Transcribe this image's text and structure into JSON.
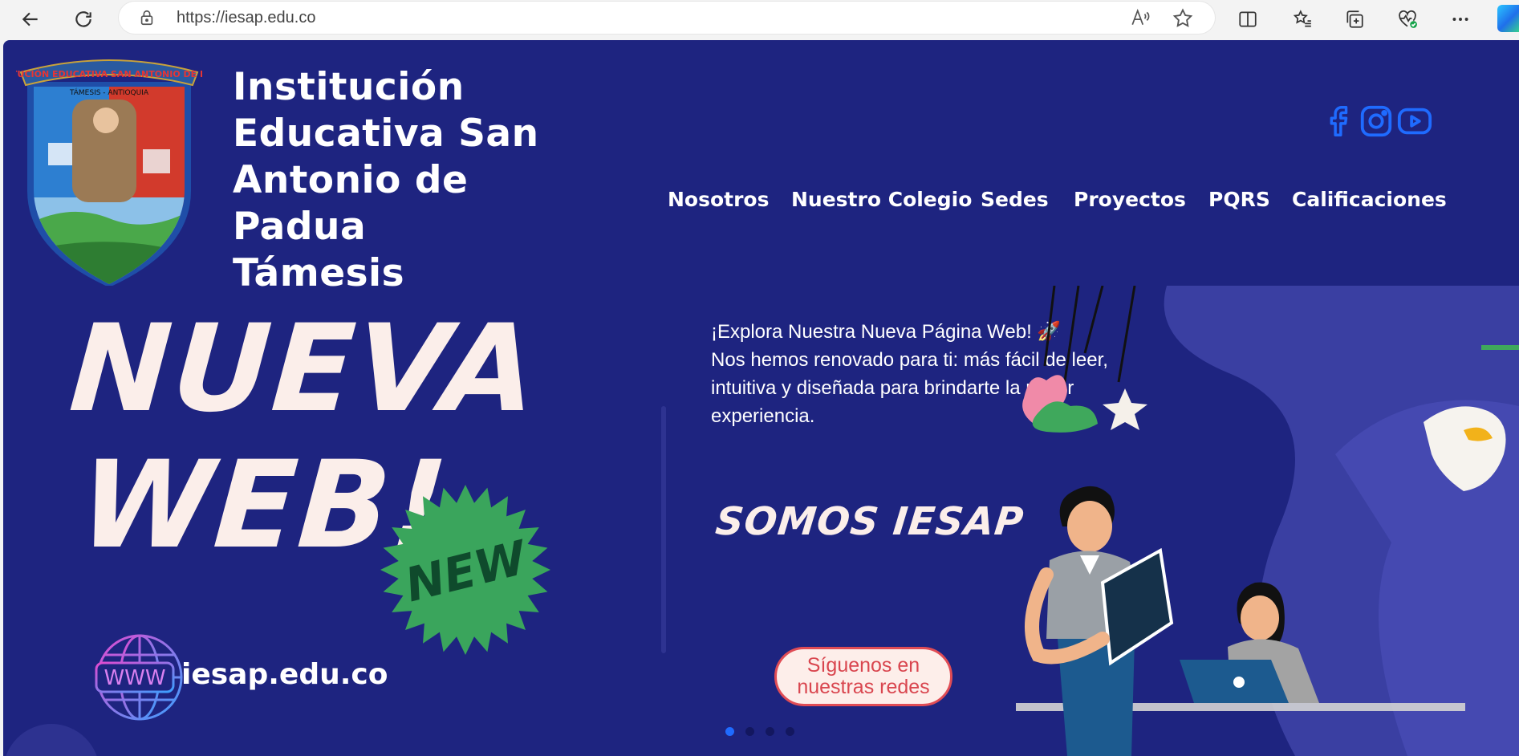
{
  "browser": {
    "url": "https://iesap.edu.co",
    "icons": [
      "back-icon",
      "refresh-icon",
      "lock-icon",
      "read-aloud-icon",
      "favorite-star-icon",
      "split-screen-icon",
      "favorites-icon",
      "collections-icon",
      "browser-essentials-icon",
      "more-icon",
      "copilot-icon"
    ]
  },
  "header": {
    "school_name_lines": [
      "Institución",
      "Educativa San",
      "Antonio de Padua",
      "Támesis"
    ],
    "crest_text": {
      "top": "INSTITUCIÓN EDUCATIVA SAN ANTONIO DE PADUA",
      "sub": "TÁMESIS - ANTIOQUIA"
    },
    "social": [
      "facebook-icon",
      "instagram-icon",
      "youtube-icon"
    ],
    "nav": [
      "Nosotros",
      "Nuestro Colegio",
      "Sedes",
      "Proyectos",
      "PQRS",
      "Calificaciones"
    ]
  },
  "hero": {
    "headline_1": "NUEVA",
    "headline_2": "WEB!",
    "badge": "NEW",
    "www_label": "WWW",
    "site_url": "iesap.edu.co",
    "explore_title": "¡Explora Nuestra Nueva Página Web! 🚀",
    "explore_body": "Nos hemos renovado para ti: más fácil de leer, intuitiva y diseñada para brindarte la mejor experiencia.",
    "somos": "SOMOS IESAP",
    "follow_button": "Síguenos en nuestras redes",
    "carousel": {
      "slides": 4,
      "active": 1
    }
  },
  "colors": {
    "background": "#1e2480",
    "accent_blue": "#1f6bff",
    "cream": "#fbeeea",
    "badge_green": "#3aa55c",
    "button_red": "#e04c55"
  }
}
